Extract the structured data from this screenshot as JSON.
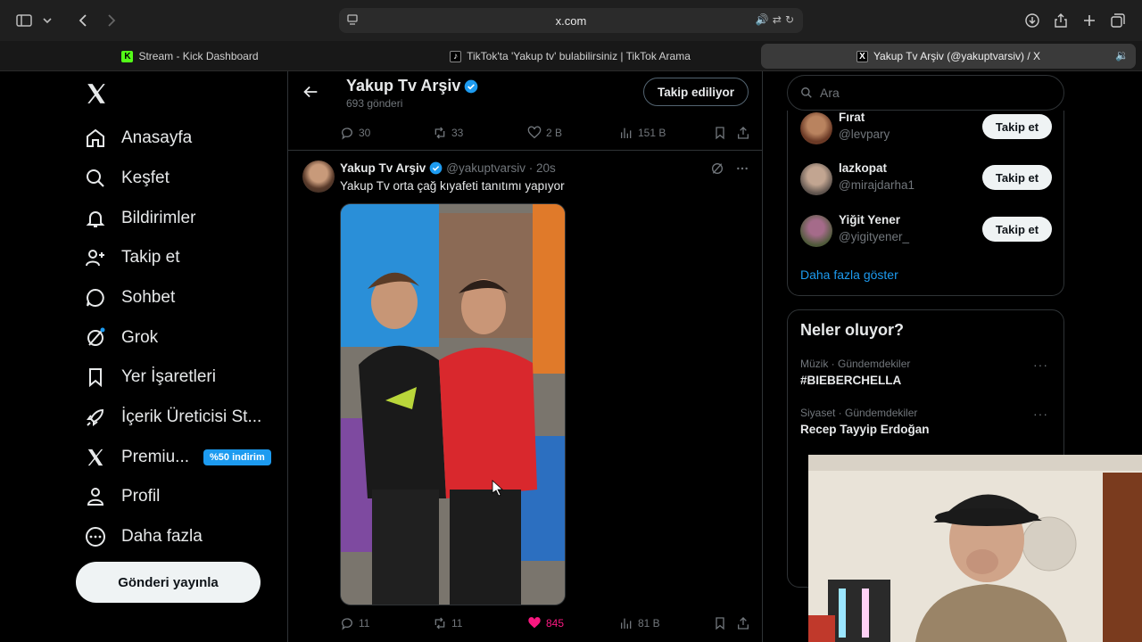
{
  "browser": {
    "url": "x.com",
    "tabs": [
      {
        "label": "Stream - Kick Dashboard",
        "favicon": "K",
        "active": false
      },
      {
        "label": "TikTok'ta 'Yakup tv' bulabilirsiniz | TikTok Arama",
        "favicon": "tiktok",
        "active": false
      },
      {
        "label": "Yakup Tv Arşiv (@yakuptvarsiv) / X",
        "favicon": "X",
        "active": true
      }
    ]
  },
  "nav": {
    "items": [
      {
        "label": "Anasayfa",
        "icon": "home-icon"
      },
      {
        "label": "Keşfet",
        "icon": "search-icon"
      },
      {
        "label": "Bildirimler",
        "icon": "bell-icon"
      },
      {
        "label": "Takip et",
        "icon": "follow-user-icon"
      },
      {
        "label": "Sohbet",
        "icon": "chat-icon"
      },
      {
        "label": "Grok",
        "icon": "grok-icon"
      },
      {
        "label": "Yer İşaretleri",
        "icon": "bookmark-icon"
      },
      {
        "label": "İçerik Üreticisi St...",
        "icon": "rocket-icon"
      },
      {
        "label": "Premiu...",
        "icon": "x-logo-icon"
      },
      {
        "label": "Profil",
        "icon": "profile-icon"
      },
      {
        "label": "Daha fazla",
        "icon": "more-circle-icon"
      }
    ],
    "premium_badge": "%50 indirim",
    "post_button": "Gönderi yayınla"
  },
  "header": {
    "title": "Yakup Tv Arşiv",
    "post_count": "693 gönderi",
    "following_label": "Takip ediliyor"
  },
  "prev_tweet_actions": {
    "replies": "30",
    "reposts": "33",
    "likes": "2 B",
    "views": "151 B"
  },
  "tweet": {
    "name": "Yakup Tv Arşiv",
    "handle_time": "@yakuptvarsiv · 20s",
    "text": "Yakup Tv orta çağ kıyafeti tanıtımı yapıyor",
    "actions": {
      "replies": "11",
      "reposts": "11",
      "likes": "845",
      "views": "81 B"
    }
  },
  "search": {
    "placeholder": "Ara"
  },
  "who_to_follow": {
    "users": [
      {
        "name": "Fırat",
        "handle": "@levpary",
        "button": "Takip et",
        "avatar_color": "#6b3a26"
      },
      {
        "name": "lazkopat",
        "handle": "@mirajdarha1",
        "button": "Takip et",
        "avatar_color": "#8a7a70"
      },
      {
        "name": "Yiğit Yener",
        "handle": "@yigityener_",
        "button": "Takip et",
        "avatar_color": "#4f5a3a"
      }
    ],
    "show_more": "Daha fazla göster"
  },
  "trends": {
    "title": "Neler oluyor?",
    "items": [
      {
        "meta": "Müzik · Gündemdekiler",
        "name": "#BIEBERCHELLA"
      },
      {
        "meta": "Siyaset · Gündemdekiler",
        "name": "Recep Tayyip Erdoğan"
      }
    ]
  },
  "colors": {
    "accent": "#1d9bf0",
    "like": "#f91880",
    "border": "#2f3336"
  }
}
